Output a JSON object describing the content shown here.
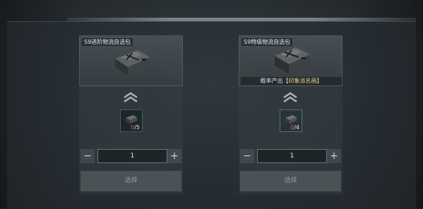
{
  "cards": [
    {
      "title": "S9进阶物流自选包",
      "probability_prefix": "",
      "probability_highlight": "",
      "item_owned": "0",
      "item_total": "/5",
      "quantity": "1",
      "confirm_label": "选择"
    },
    {
      "title": "S9特级物流自选包",
      "probability_prefix": "概率产出【",
      "probability_highlight": "印象派名画",
      "probability_suffix": "】",
      "item_owned": "0",
      "item_total": "/4",
      "quantity": "1",
      "confirm_label": "选择"
    }
  ],
  "controls": {
    "minus": "−",
    "plus": "+"
  },
  "colors": {
    "owned_count": "#e05a4a",
    "highlight": "#e7d38a",
    "background": "#262c30"
  },
  "icons": [
    "supply-case-icon",
    "chevron-up-icon",
    "material-box-icon"
  ]
}
